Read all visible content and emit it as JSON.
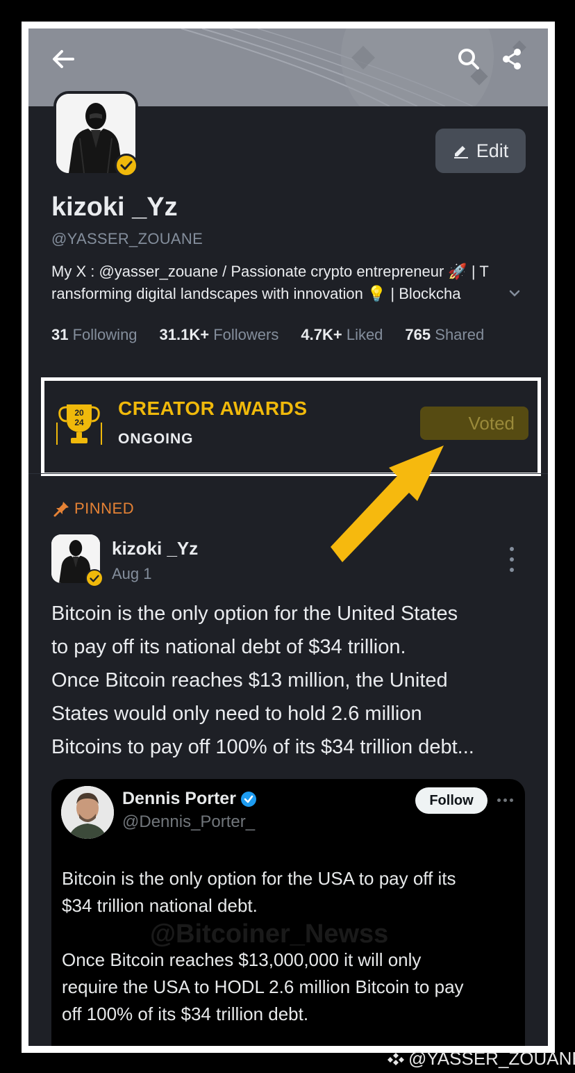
{
  "colors": {
    "background": "#1e2026",
    "accent": "#f0b90b",
    "pinned": "#e58235",
    "arrow": "#f6b90e"
  },
  "header": {
    "back_icon": "arrow-left-icon",
    "search_icon": "search-icon",
    "share_icon": "share-icon"
  },
  "profile": {
    "display_name": "kizoki _Yz",
    "handle": "@YASSER_ZOUANE",
    "edit_label": "Edit",
    "bio_line1": "My X : @yasser_zouane / Passionate crypto entrepreneur 🚀 | T",
    "bio_line2": "ransforming digital landscapes with innovation 💡 | Blockcha",
    "stats": [
      {
        "value": "31",
        "label": "Following"
      },
      {
        "value": "31.1K+",
        "label": "Followers"
      },
      {
        "value": "4.7K+",
        "label": "Liked"
      },
      {
        "value": "765",
        "label": "Shared"
      }
    ]
  },
  "awards": {
    "title": "CREATOR AWARDS",
    "status": "ONGOING",
    "trophy_year_top": "20",
    "trophy_year_bottom": "24",
    "vote_button": "Voted"
  },
  "post": {
    "pinned_label": "PINNED",
    "author": "kizoki _Yz",
    "date": "Aug 1",
    "text_lines": [
      "Bitcoin is the only option for the United States",
      "to pay off its national debt of $34 trillion.",
      "Once Bitcoin reaches $13 million, the United",
      "States would only need to hold 2.6 million",
      "Bitcoins to pay off 100% of its $34 trillion debt..."
    ],
    "quote": {
      "name": "Dennis Porter",
      "handle": "@Dennis_Porter_",
      "follow_label": "Follow",
      "watermark": "@Bitcoiner_Newss",
      "text_lines": [
        "Bitcoin is the only option for the USA to pay off its",
        "$34 trillion national debt.",
        "",
        "Once Bitcoin reaches $13,000,000 it will only",
        "require the USA to HODL 2.6 million Bitcoin to pay",
        "off 100% of its $34 trillion debt."
      ]
    }
  },
  "footer": {
    "watermark": "@YASSER_ZOUANE"
  }
}
